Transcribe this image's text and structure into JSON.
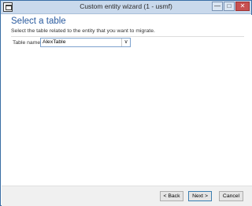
{
  "window": {
    "title": "Custom entity wizard (1 - usmf)",
    "minimize_glyph": "—",
    "maximize_glyph": "□",
    "close_glyph": "✕",
    "icon": "window-app-icon"
  },
  "page": {
    "heading": "Select a table",
    "description": "Select the table related to the entity that you want to migrate."
  },
  "table_field": {
    "label": "Table name:",
    "value": "AlexTable",
    "dropdown_glyph": "∨"
  },
  "footer": {
    "back_label": "< Back",
    "next_label": "Next >",
    "cancel_label": "Cancel"
  },
  "colors": {
    "heading": "#2a5b9f",
    "titlebar": "#c9d9ec",
    "close_button": "#c75050"
  }
}
